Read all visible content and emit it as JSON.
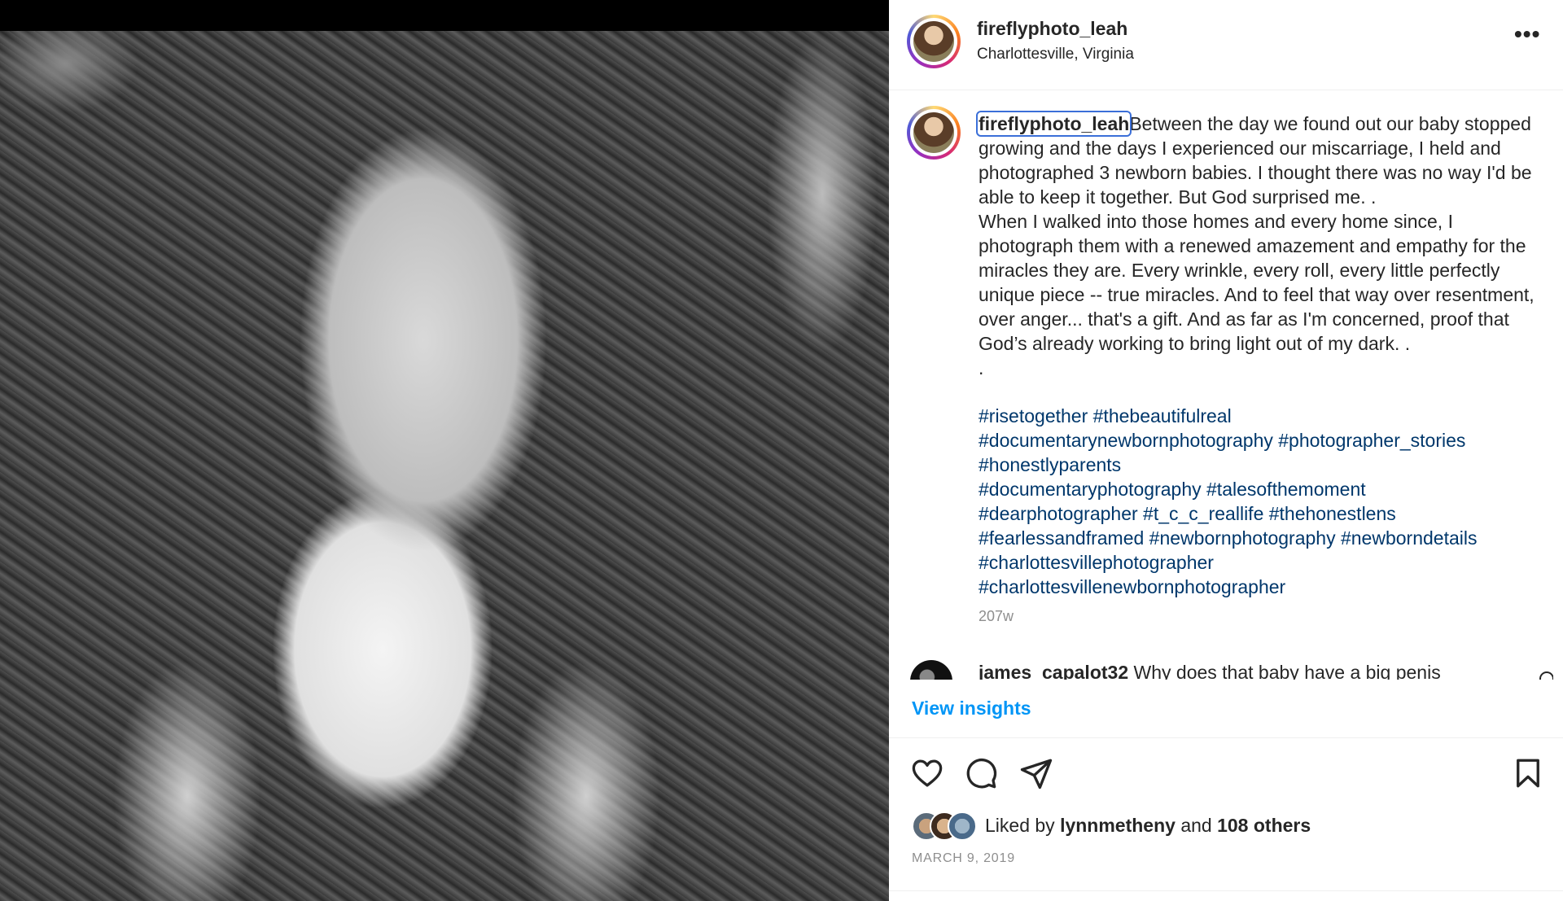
{
  "post": {
    "username": "fireflyphoto_leah",
    "location": "Charlottesville, Virginia",
    "more_icon": "more-horizontal-icon",
    "more_label": "•••"
  },
  "caption": {
    "username": "fireflyphoto_leah",
    "text": "Between the day we found out our baby stopped growing and the days I experienced our miscarriage, I held and photographed 3 newborn babies. I thought there was no way I'd be able to keep it together. But God surprised me. .\nWhen I walked into those homes and every home since, I photograph them with a renewed amazement and empathy for the miracles they are. Every wrinkle, every roll, every little perfectly unique piece -- true miracles. And to feel that way over resentment, over anger... that's a gift. And as far as I'm concerned, proof that God’s already working to bring light out of my dark. .\n.",
    "hashtag_lines": [
      "#risetogether #thebeautifulreal",
      "#documentarynewbornphotography #photographer_stories",
      "#honestlyparents",
      "#documentaryphotography #talesofthemoment",
      "#dearphotographer #t_c_c_reallife #thehonestlens",
      "#fearlessandframed #newbornphotography #newborndetails",
      "#charlottesvillephotographer",
      "#charlottesvillenewbornphotographer"
    ],
    "time": "207w"
  },
  "comment": {
    "username": "james_capalot32",
    "text": "Why does that baby have a big penis"
  },
  "insights_label": "View insights",
  "actions": {
    "like": "heart-icon",
    "comment": "comment-icon",
    "share": "paper-plane-icon",
    "save": "bookmark-icon"
  },
  "likes": {
    "prefix": "Liked by ",
    "user": "lynnmetheny",
    "middle": " and ",
    "others": "108 others"
  },
  "date": "MARCH 9, 2019",
  "colors": {
    "link": "#00376b",
    "accent": "#0095f6",
    "muted": "#8e8e8e"
  }
}
